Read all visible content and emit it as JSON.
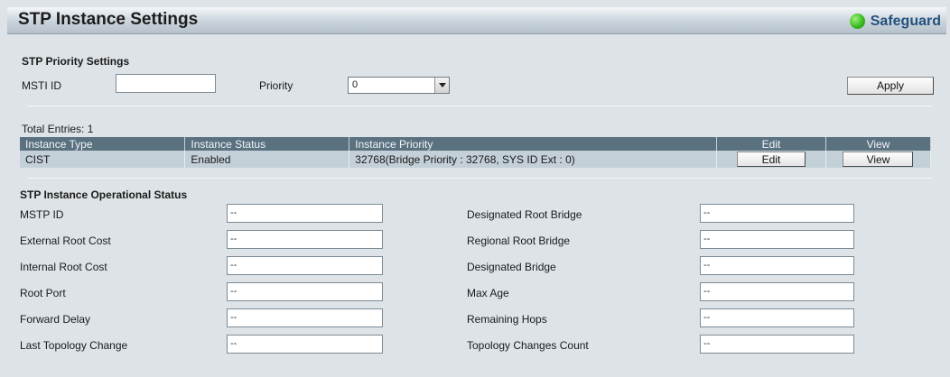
{
  "header": {
    "title": "STP Instance Settings",
    "safeguard": "Safeguard"
  },
  "priority_settings": {
    "section_title": "STP Priority Settings",
    "msti_label": "MSTI ID",
    "msti_value": "",
    "priority_label": "Priority",
    "priority_value": "0",
    "apply_label": "Apply"
  },
  "entries": {
    "total": "Total Entries: 1",
    "columns": [
      "Instance Type",
      "Instance Status",
      "Instance Priority",
      "Edit",
      "View"
    ],
    "rows": [
      {
        "type": "CIST",
        "status": "Enabled",
        "priority": "32768(Bridge Priority : 32768, SYS ID Ext : 0)",
        "edit_label": "Edit",
        "view_label": "View"
      }
    ]
  },
  "operational": {
    "section_title": "STP Instance Operational Status",
    "left": [
      {
        "label": "MSTP ID",
        "value": "--"
      },
      {
        "label": "External Root Cost",
        "value": "--"
      },
      {
        "label": "Internal Root Cost",
        "value": "--"
      },
      {
        "label": "Root Port",
        "value": "--"
      },
      {
        "label": "Forward Delay",
        "value": "--"
      },
      {
        "label": "Last Topology Change",
        "value": "--"
      }
    ],
    "right": [
      {
        "label": "Designated Root Bridge",
        "value": "--"
      },
      {
        "label": "Regional Root Bridge",
        "value": "--"
      },
      {
        "label": "Designated Bridge",
        "value": "--"
      },
      {
        "label": "Max Age",
        "value": "--"
      },
      {
        "label": "Remaining Hops",
        "value": "--"
      },
      {
        "label": "Topology Changes Count",
        "value": "--"
      }
    ]
  },
  "colors": {
    "header_row": "#5a7180",
    "data_row": "#c4d0d8",
    "background": "#dde3e7",
    "safeguard_text": "#24527e"
  }
}
